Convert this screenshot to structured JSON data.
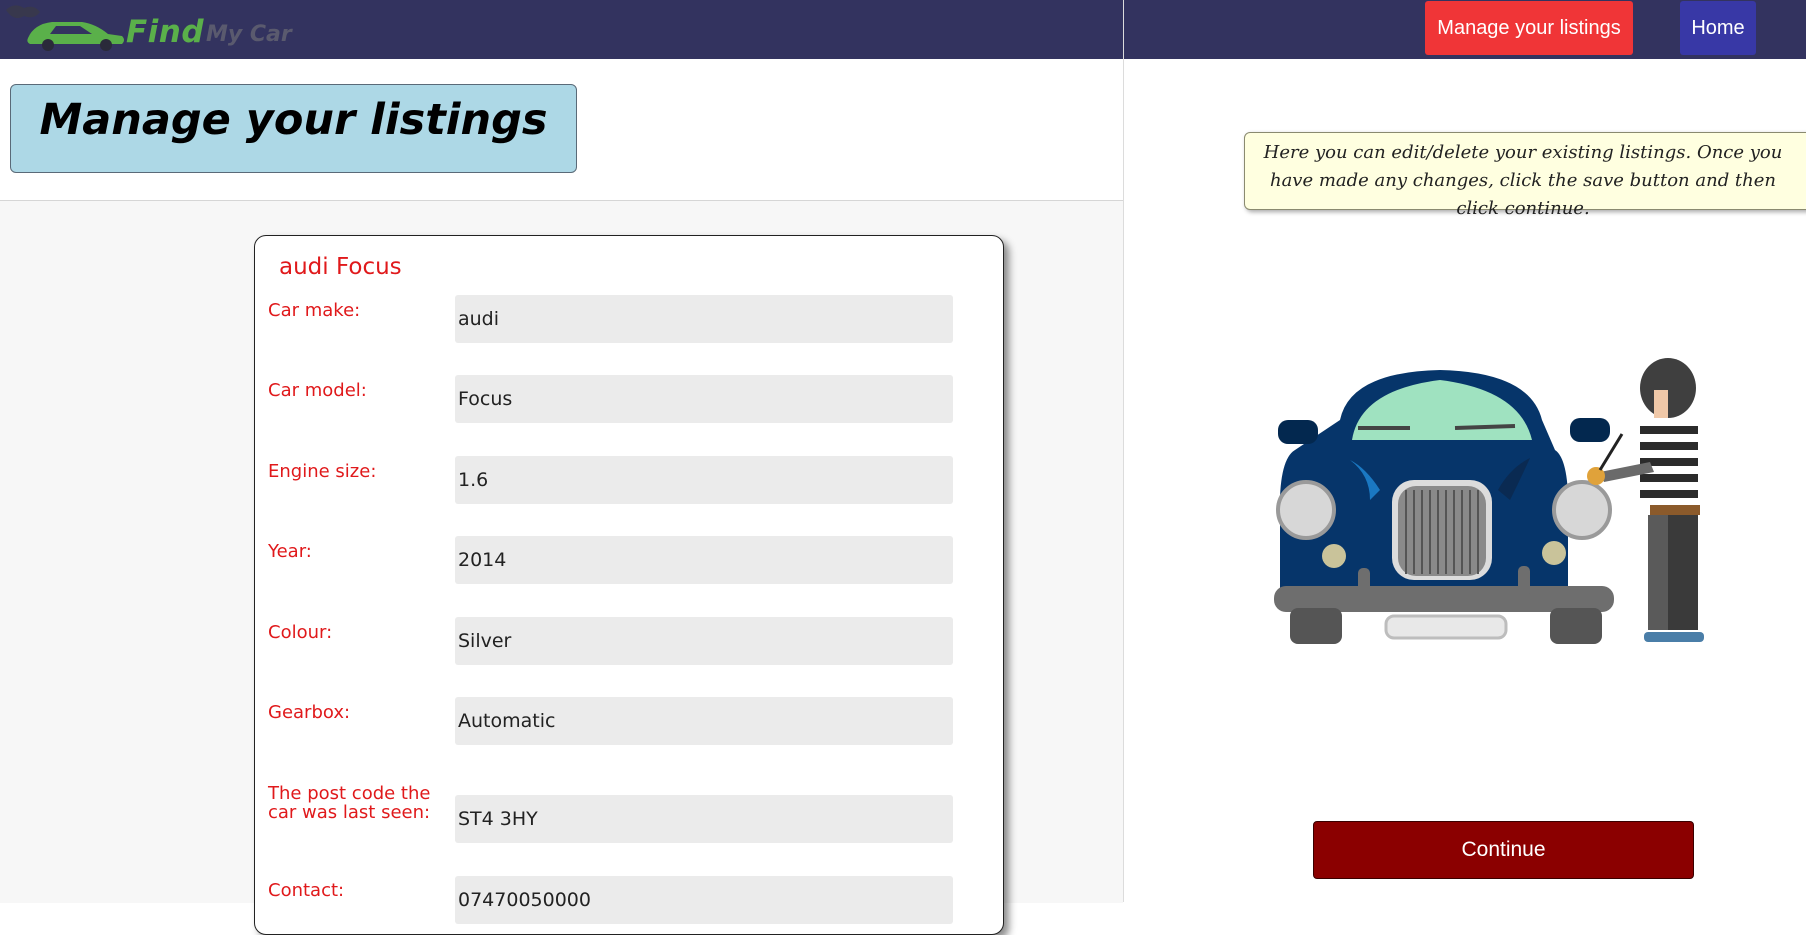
{
  "header": {
    "logo_find": "Find",
    "logo_mycar": "My Car",
    "nav_manage_label": "Manage your listings",
    "nav_home_label": "Home"
  },
  "page_title": "Manage your listings",
  "listing": {
    "title": "audi Focus",
    "fields": [
      {
        "label": "Car make:",
        "value": "audi"
      },
      {
        "label": "Car model:",
        "value": "Focus"
      },
      {
        "label": "Engine size:",
        "value": "1.6"
      },
      {
        "label": "Year:",
        "value": "2014"
      },
      {
        "label": "Colour:",
        "value": "Silver"
      },
      {
        "label": "Gearbox:",
        "value": "Automatic"
      },
      {
        "label": "The post code the car was last seen:",
        "value": "ST4 3HY"
      },
      {
        "label": "Contact:",
        "value": "07470050000"
      }
    ]
  },
  "tip_text": "Here you can edit/delete your existing listings. Once you have made any changes, click the save button and then click continue.",
  "continue_label": "Continue",
  "colors": {
    "topbar": "#33335f",
    "nav_manage": "#f03537",
    "nav_home": "#3838a6",
    "label_red": "#e0191b",
    "continue": "#8b0000",
    "title_box": "#add8e6",
    "tip_bg": "#ffffe0"
  },
  "icons": {
    "logo": "green-car-logo-icon",
    "illustration": "car-thief-illustration"
  }
}
